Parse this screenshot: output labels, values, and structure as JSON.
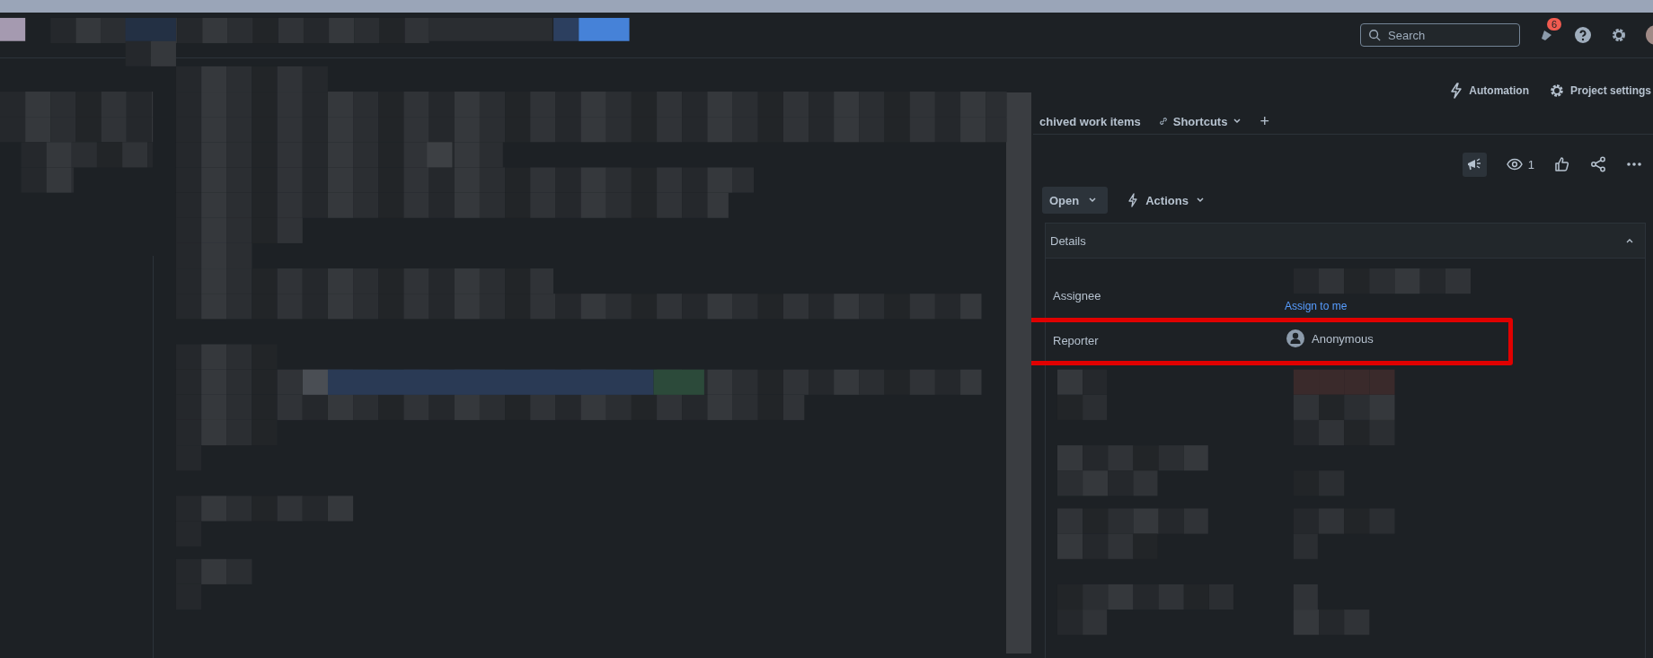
{
  "top_bar": {
    "search": {
      "placeholder": "Search"
    },
    "notifications": {
      "badge": "6"
    }
  },
  "header_actions": [
    {
      "label": "Automation",
      "kind": "automation"
    },
    {
      "label": "Project settings",
      "kind": "settings"
    }
  ],
  "tabs": [
    {
      "label": "chived work items",
      "kind": "plain"
    },
    {
      "label": "Shortcuts",
      "kind": "dropdown"
    },
    {
      "label": "+",
      "kind": "add"
    }
  ],
  "toolbar": {
    "watchers": "1"
  },
  "status_button": "Open",
  "actions_button": "Actions",
  "details": {
    "title": "Details",
    "expanded": true,
    "fields": [
      {
        "label": "Assignee",
        "link": "Assign to me",
        "highlighted": false
      },
      {
        "label": "Reporter",
        "value": "Anonymous",
        "highlighted": true
      }
    ]
  }
}
